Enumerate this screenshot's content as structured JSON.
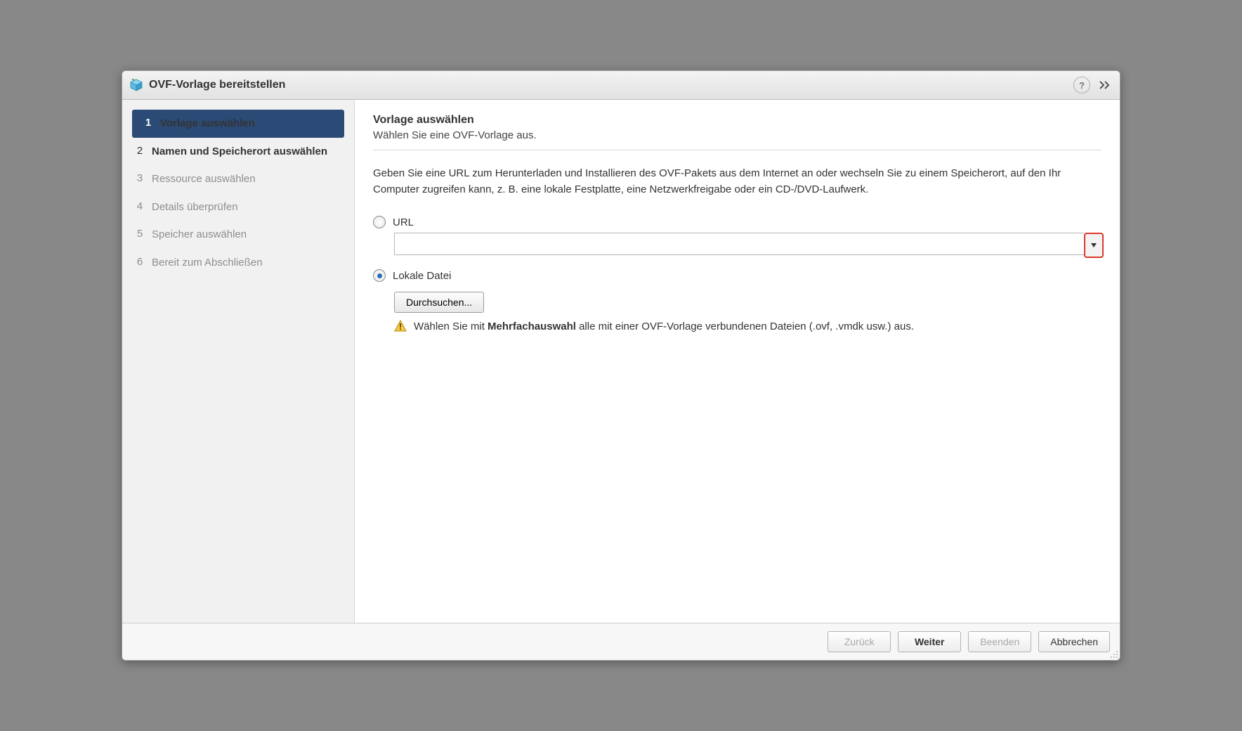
{
  "window": {
    "title": "OVF-Vorlage bereitstellen"
  },
  "sidebar": {
    "steps": [
      {
        "num": "1",
        "label": "Vorlage auswählen",
        "active": true,
        "enabled": true
      },
      {
        "num": "2",
        "label": "Namen und Speicherort auswählen",
        "active": false,
        "enabled": true
      },
      {
        "num": "3",
        "label": "Ressource auswählen",
        "active": false,
        "enabled": false
      },
      {
        "num": "4",
        "label": "Details überprüfen",
        "active": false,
        "enabled": false
      },
      {
        "num": "5",
        "label": "Speicher auswählen",
        "active": false,
        "enabled": false
      },
      {
        "num": "6",
        "label": "Bereit zum Abschließen",
        "active": false,
        "enabled": false
      }
    ]
  },
  "main": {
    "heading": "Vorlage auswählen",
    "subtitle": "Wählen Sie eine OVF-Vorlage aus.",
    "description": "Geben Sie eine URL zum Herunterladen und Installieren des OVF-Pakets aus dem Internet an oder wechseln Sie zu einem Speicherort, auf den Ihr Computer zugreifen kann, z. B. eine lokale Festplatte, eine Netzwerkfreigabe oder ein CD-/DVD-Laufwerk.",
    "url_option": {
      "label": "URL",
      "value": "",
      "selected": false
    },
    "local_option": {
      "label": "Lokale Datei",
      "selected": true
    },
    "browse_label": "Durchsuchen...",
    "warning_pre": "Wählen Sie mit ",
    "warning_bold": "Mehrfachauswahl",
    "warning_post": " alle mit einer OVF-Vorlage verbundenen Dateien (.ovf, .vmdk usw.) aus."
  },
  "footer": {
    "back": "Zurück",
    "next": "Weiter",
    "finish": "Beenden",
    "cancel": "Abbrechen"
  }
}
